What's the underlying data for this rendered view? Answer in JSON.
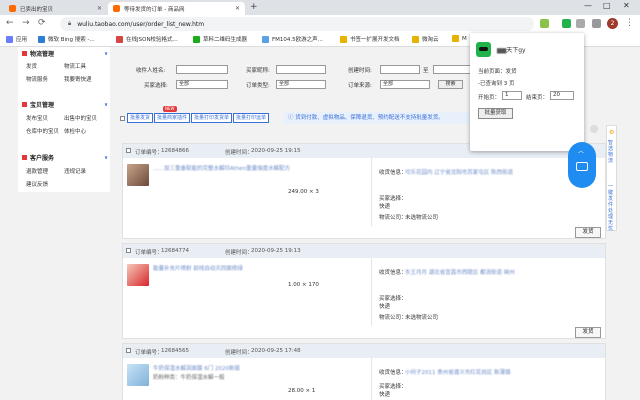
{
  "browser": {
    "tabs": [
      {
        "title": "已卖出的宝贝"
      },
      {
        "title": "等待发货的订单 - 商品网"
      }
    ],
    "window_controls": [
      "—",
      "□",
      "✕"
    ],
    "url": "wuliu.taobao.com/user/order_list_new.htm",
    "bookmarks": [
      "应用",
      "微软 Bing 搜索 -...",
      "在线JSON校验格式...",
      "草料二维码生成器",
      "FM104.5欧游之声...",
      "书签一扩展开发文档",
      "微淘云",
      "M"
    ]
  },
  "sidebar": {
    "sections": [
      {
        "title": "物流管理",
        "links": [
          "发货",
          "物流工具",
          "物流服务",
          "我要寄快递"
        ]
      },
      {
        "title": "宝贝管理",
        "links": [
          "发布宝贝",
          "出售中的宝贝",
          "仓库中的宝贝",
          "体检中心"
        ]
      },
      {
        "title": "客户服务",
        "links": [
          "退款管理",
          "违规记录",
          "建议反馈"
        ]
      }
    ]
  },
  "filter": {
    "labels": [
      "收件人姓名:",
      "买家昵称:",
      "创建时间:",
      "至",
      "买家选择:",
      "订单类型:",
      "订单来源:"
    ],
    "select_value": "全部",
    "search_label": "搜索"
  },
  "actions": {
    "buttons": [
      "批量发货",
      "批量商家插件",
      "批量打印发货单",
      "批量打印运单"
    ],
    "new_badge": "NEW",
    "notice": "货到付款、虚拟物品、保障退货、预约配送不支持批量发货。"
  },
  "orders": [
    {
      "order_no_label": "订单编号：",
      "order_no": "12684866",
      "created_label": "创建时间：",
      "created": "2020-09-25 19:15",
      "title": "……双三重垂取能的完整水解印Athen重量强度水解配方",
      "qty": "249.00 × 3",
      "recv_label": "收货信息：",
      "recv": "可乐花园内 辽宁省沈阳市苏家屯区 陈西街道",
      "buyer_sel_label": "买家选择：",
      "buyer_sel": "快递",
      "logistics_label": "物流公司：",
      "logistics": "未选物流公司",
      "ship": "发货"
    },
    {
      "order_no_label": "订单编号：",
      "order_no": "12684774",
      "created_label": "创建时间：",
      "created": "2020-09-25 19:13",
      "title": "能量补充片喷射 前线自动灭四面修绿",
      "qty": "1.00 × 170",
      "recv_label": "收货信息：",
      "recv": "东王月月 湖北省宜昌市西陵区 都消街道 峡州",
      "buyer_sel_label": "买家选择：",
      "buyer_sel": "快递",
      "logistics_label": "物流公司：",
      "logistics": "未选物流公司",
      "ship": "发货"
    },
    {
      "order_no_label": "订单编号：",
      "order_no": "12684565",
      "created_label": "创建时间：",
      "created": "2020-09-25 17:48",
      "title": "牛奶保湿水解润面膜 6门 2020新版",
      "subtitle": "奶粉种类：牛奶保湿水解一般",
      "qty": "28.00 × 1",
      "recv_label": "收货信息：",
      "recv": "小何子2011 贵州省遵义市红花岗区 新蒲镇",
      "buyer_sel_label": "买家选择：",
      "buyer_sel": "快递"
    }
  ],
  "popup": {
    "title": "天下gy",
    "current_page_label": "当前页面：",
    "current_page": "发货",
    "found": "-已查询到 3 页",
    "start_label": "开始页：",
    "start_value": "1",
    "end_label": "结束页：",
    "end_value": "20",
    "batch_label": "批量获取"
  },
  "floating": {
    "side_text_1": "智选物流",
    "side_text_2": "一键发件处理无忧"
  }
}
